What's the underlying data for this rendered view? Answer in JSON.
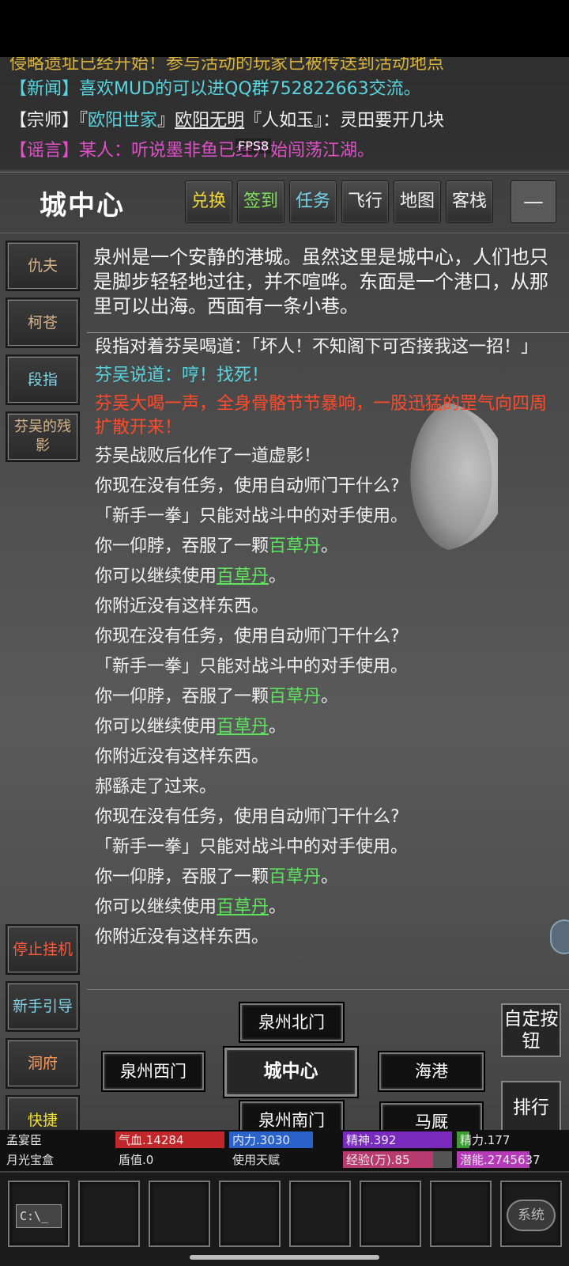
{
  "news": {
    "line0_tag": "",
    "line0_text": "侵略遗址已经开始！参与活动的玩家已被传送到活动地点",
    "line1_tag": "【新闻】",
    "line1_text": "喜欢MUD的可以进QQ群752822663交流。",
    "line2_tag": "【宗师】",
    "line2_family_open": "『",
    "line2_family": "欧阳世家",
    "line2_family_close": "』",
    "line2_name": "欧阳无明",
    "line2_nick": "『人如玉』",
    "line2_text": "：灵田要开几块",
    "line3_tag": "【谣言】",
    "line3_text": "某人：听说墨非鱼已经开始闯荡江湖。",
    "fps": "FPS8"
  },
  "header": {
    "room_title": "城中心",
    "buttons": [
      "兑换",
      "签到",
      "任务",
      "飞行",
      "地图",
      "客栈"
    ],
    "minus": "—"
  },
  "sidebar": {
    "npcs": [
      "仇夫",
      "柯苍",
      "段指",
      "芬吴的残影"
    ],
    "actions": [
      "停止挂机",
      "新手引导",
      "洞府",
      "快捷"
    ]
  },
  "description": "泉州是一个安静的港城。虽然这里是城中心，人们也只是脚步轻轻地过往，并不喧哗。东面是一个港口，从那里可以出海。西面有一条小巷。",
  "log": {
    "l1": "段指对着芬吴喝道：「坏人！不知阁下可否接我这一招！」",
    "l2": "芬吴说道：哼！找死！",
    "l3": "芬吴大喝一声，全身骨骼节节暴响，一股迅猛的罡气向四周扩散开来！",
    "l4": "芬吴战败后化作了一道虚影！",
    "no_task": "你现在没有任务，使用自动师门干什么?",
    "fist": "「新手一拳」只能对战斗中的对手使用。",
    "swallow": "你一仰脖，吞服了一颗",
    "continue": "你可以继续使用",
    "pill": "百草丹",
    "period": "。",
    "nothing": "你附近没有这样东西。",
    "walk": "郝繇走了过来。"
  },
  "exits": {
    "north": "泉州北门",
    "west": "泉州西门",
    "center": "城中心",
    "east": "海港",
    "south": "泉州南门",
    "southeast": "马厩"
  },
  "right_buttons": {
    "custom": "自定按钮",
    "rank": "排行"
  },
  "stats": {
    "name": "孟宴臣",
    "hp": "气血.14284",
    "mp": "内力.3030",
    "spirit": "精神.392",
    "energy": "精力.177",
    "item": "月光宝盒",
    "shield": "盾值.0",
    "talent": "使用天赋",
    "exp": "经验(万).85",
    "potential": "潜能.2745637",
    "colors": {
      "hp": "#c0262a",
      "mp": "#2a62c9",
      "spirit": "#7a2bbd",
      "energy": "#3d9b35",
      "exp": "#b83a6e",
      "potential": "#b43ab8"
    }
  },
  "slots": {
    "console": "C:\\_",
    "system": "系统"
  }
}
